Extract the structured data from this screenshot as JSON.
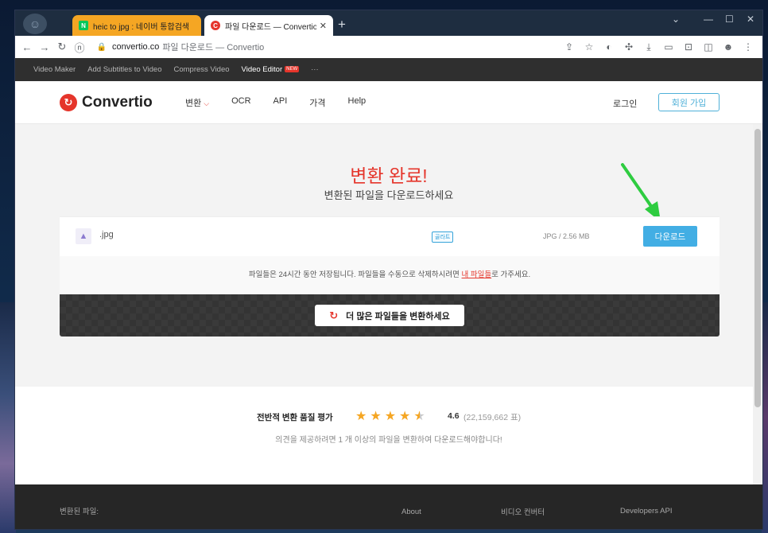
{
  "browser": {
    "tabs": [
      {
        "label": "heic to jpg : 네이버 통합검색",
        "favicon": "N"
      },
      {
        "label": "파일 다운로드 — Convertio",
        "favicon": "C"
      }
    ],
    "new_tab": "+",
    "address": {
      "domain": "convertio.co",
      "page_title": "파일 다운로드 — Convertio"
    }
  },
  "promo_bar": {
    "items": [
      "Video Maker",
      "Add Subtitles to Video",
      "Compress Video"
    ],
    "active": "Video Editor",
    "badge": "NEW",
    "more": "···"
  },
  "nav": {
    "logo": "Convertio",
    "links": [
      "변환",
      "OCR",
      "API",
      "가격",
      "Help"
    ],
    "login": "로그인",
    "signup": "회원 가입"
  },
  "hero": {
    "title": "변환 완료!",
    "subtitle": "변환된 파일을 다운로드하세요"
  },
  "file": {
    "name": ".jpg",
    "quality_badge": "골라트",
    "size": "JPG / 2.56 MB",
    "download_label": "다운로드"
  },
  "info": {
    "before": "파일들은 24시간 동안 저장됩니다. 파일들을 수동으로 삭제하시려면 ",
    "link": "내 파일들",
    "after": "로 가주세요."
  },
  "convert_more": "더 많은 파일들을 변환하세요",
  "rating": {
    "title": "전반적 변환 품질 평가",
    "score": "4.6",
    "score_value": 4.6,
    "votes": "(22,159,662 표)",
    "note": "의견을 제공하려면 1 개 이상의 파일을 변환하여 다운로드해야합니다!"
  },
  "footer": {
    "converted_files": "변환된 파일:",
    "about": "About",
    "video_converter": "비디오 컨버터",
    "developers": "Developers API"
  },
  "colors": {
    "brand": "#e5352b",
    "accent": "#42aee4",
    "star": "#f5a623"
  }
}
